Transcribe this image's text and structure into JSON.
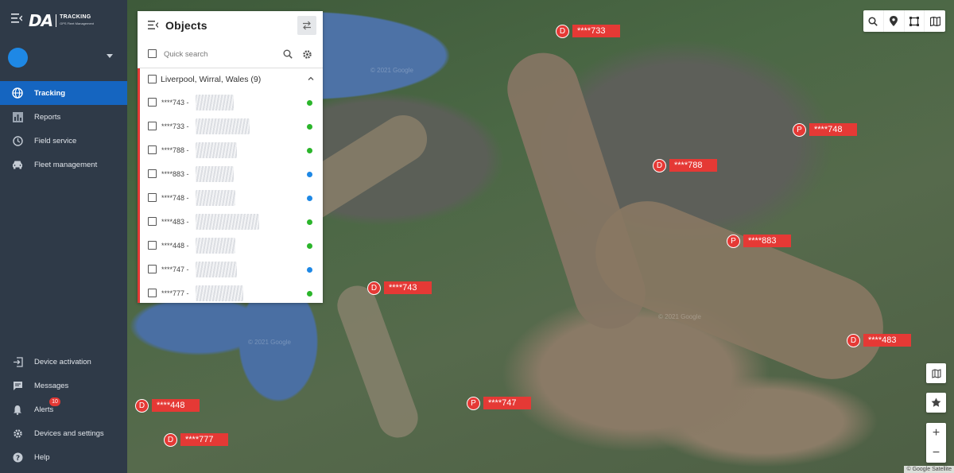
{
  "app": {
    "logo_text": "DA",
    "logo_product": "TRACKING",
    "logo_tagline": "GPS Fleet Management"
  },
  "sidebar": {
    "nav": [
      {
        "label": "Tracking",
        "icon": "globe-icon",
        "active": true
      },
      {
        "label": "Reports",
        "icon": "bar-chart-icon",
        "active": false
      },
      {
        "label": "Field service",
        "icon": "clock-icon",
        "active": false
      },
      {
        "label": "Fleet management",
        "icon": "car-icon",
        "active": false
      }
    ],
    "bottom": [
      {
        "label": "Device activation",
        "icon": "login-icon"
      },
      {
        "label": "Messages",
        "icon": "chat-icon"
      },
      {
        "label": "Alerts",
        "icon": "bell-icon",
        "badge": "10"
      },
      {
        "label": "Devices and settings",
        "icon": "gear-icon"
      },
      {
        "label": "Help",
        "icon": "help-icon"
      }
    ]
  },
  "panel": {
    "title": "Objects",
    "search_placeholder": "Quick search",
    "group": {
      "label": "Liverpool, Wirral, Wales (9)",
      "rows": [
        {
          "label": "****743 -",
          "status_color": "#2bb52b"
        },
        {
          "label": "****733 -",
          "status_color": "#2bb52b"
        },
        {
          "label": "****788 -",
          "status_color": "#2bb52b"
        },
        {
          "label": "****883 -",
          "status_color": "#1e88e5"
        },
        {
          "label": "****748 -",
          "status_color": "#1e88e5"
        },
        {
          "label": "****483 -",
          "status_color": "#2bb52b"
        },
        {
          "label": "****448 -",
          "status_color": "#2bb52b"
        },
        {
          "label": "****747 -",
          "status_color": "#1e88e5"
        },
        {
          "label": "****777 -",
          "status_color": "#2bb52b"
        }
      ]
    }
  },
  "map": {
    "watermarks": [
      "© 2021 Google",
      "© 2021 Google",
      "© 2021 Google"
    ],
    "attribution": "© Google Satellite",
    "markers": [
      {
        "state": "D",
        "label": "****733"
      },
      {
        "state": "P",
        "label": "****748"
      },
      {
        "state": "D",
        "label": "****788"
      },
      {
        "state": "P",
        "label": "****883"
      },
      {
        "state": "D",
        "label": "****743"
      },
      {
        "state": "D",
        "label": "****483"
      },
      {
        "state": "P",
        "label": "****747"
      },
      {
        "state": "D",
        "label": "****448"
      },
      {
        "state": "D",
        "label": "****777"
      }
    ],
    "zoom_in": "+",
    "zoom_out": "−"
  },
  "colors": {
    "sidebar_bg": "#2f3a48",
    "active_nav": "#1565c0",
    "marker_red": "#e53935",
    "status_green": "#2bb52b",
    "status_blue": "#1e88e5"
  }
}
